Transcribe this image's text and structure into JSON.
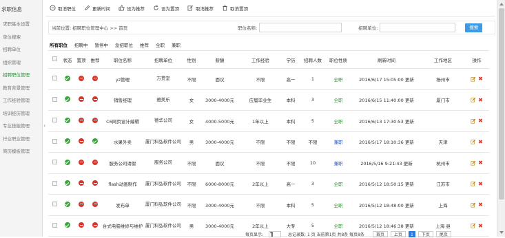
{
  "sidebar": {
    "title": "求职信息",
    "items": [
      {
        "label": "求职基本设置",
        "active": false
      },
      {
        "label": "单位搜索",
        "active": false
      },
      {
        "label": "招聘单位",
        "active": false
      },
      {
        "label": "组织管理",
        "active": false
      },
      {
        "label": "招聘职位管理",
        "active": true
      },
      {
        "label": "教育背景管理",
        "active": false
      },
      {
        "label": "工作经验管理",
        "active": false
      },
      {
        "label": "培训经历管理",
        "active": false
      },
      {
        "label": "专业技能管理",
        "active": false
      },
      {
        "label": "行业职业管理",
        "active": false
      },
      {
        "label": "简历模板管理",
        "active": false
      }
    ]
  },
  "toolbar": {
    "items": [
      {
        "label": "取消职位",
        "icon": "circle-minus-icon"
      },
      {
        "label": "更新时间",
        "icon": "pencil-icon"
      },
      {
        "label": "设为推荐",
        "icon": "thumb-up-icon"
      },
      {
        "label": "设为置顶",
        "icon": "refresh-icon"
      },
      {
        "label": "取消推荐",
        "icon": "edit-icon"
      },
      {
        "label": "取消置顶",
        "icon": "trash-icon"
      }
    ]
  },
  "breadcrumb": "当前位置: 招聘职位管理中心 >> 首页",
  "filters": {
    "position_label": "职位名称:",
    "position_value": "",
    "company_label": "招聘单位:",
    "company_value": "",
    "search_label": "搜索"
  },
  "tabs": [
    {
      "label": "所有职位",
      "active": true
    },
    {
      "label": "招聘中",
      "active": false
    },
    {
      "label": "暂停中",
      "active": false
    },
    {
      "label": "急招职位",
      "active": false
    },
    {
      "label": "推荐",
      "active": false
    },
    {
      "label": "全职",
      "active": false
    },
    {
      "label": "兼职",
      "active": false
    }
  ],
  "columns": [
    "状态",
    "置顶",
    "推荐",
    "职位名称",
    "招聘单位",
    "性别",
    "薪酬",
    "工作经验",
    "学历",
    "招聘人数",
    "职位性质",
    "刷新时间",
    "工作地区",
    "操作"
  ],
  "rows": [
    {
      "status": "green",
      "top": "red",
      "recommend": "red",
      "name": "yz管理",
      "company": "万贯堂",
      "gender": "不限",
      "salary": "面议",
      "experience": "不限",
      "education": "高一",
      "count": "1",
      "nature": "全职",
      "refresh": "2016/6/17 15:05:00 更新",
      "region": "杨州市"
    },
    {
      "status": "green",
      "top": "red",
      "recommend": "red",
      "name": "销售经理",
      "company": "雅美乐",
      "gender": "女",
      "salary": "3000-4000元",
      "experience": "应届毕业生",
      "education": "本科",
      "count": "3",
      "nature": "全职",
      "refresh": "2016/6/15 11:40:00 更新",
      "region": "厦门市"
    },
    {
      "status": "green",
      "top": "red",
      "recommend": "red",
      "name": "C6网页设计编辑",
      "company": "德华公司",
      "gender": "女",
      "salary": "4000-5000元",
      "experience": "1年以上",
      "education": "本科",
      "count": "5",
      "nature": "全职",
      "refresh": "2016/6/13 17:30:53 更新",
      "region": ""
    },
    {
      "status": "green",
      "top": "red",
      "recommend": "green",
      "name": "水果外卖",
      "company": "厦门科弘软件公司",
      "gender": "男",
      "salary": "3000-4000元",
      "experience": "不限",
      "education": "不限",
      "count": "不限",
      "nature": "兼职",
      "refresh": "2016/5/17 18:10:36 更新",
      "region": "天津"
    },
    {
      "status": "green",
      "top": "red",
      "recommend": "red",
      "name": "服务公司请假",
      "company": "服务公司",
      "gender": "不限",
      "salary": "面议",
      "experience": "不限",
      "education": "不限",
      "count": "10",
      "nature": "兼职",
      "refresh": "2016/5/16 9:21:43 更新",
      "region": "杭州市"
    },
    {
      "status": "green",
      "top": "red",
      "recommend": "red",
      "name": "flash动画制作",
      "company": "厦门科弘软件公司",
      "gender": "不限",
      "salary": "6000-8000元",
      "experience": "2年以上",
      "education": "高一",
      "count": "3",
      "nature": "全职",
      "refresh": "2016/5/12 18:50:15 更新",
      "region": "江苏市"
    },
    {
      "status": "green",
      "top": "red",
      "recommend": "red",
      "name": "发布单",
      "company": "厦门科弘软件公司",
      "gender": "不限",
      "salary": "3000-4000元",
      "experience": "不限",
      "education": "本科",
      "count": "5",
      "nature": "全职",
      "refresh": "2016/5/12 18:48:00 更新",
      "region": "上海"
    },
    {
      "status": "green",
      "top": "red",
      "recommend": "red",
      "name": "台式电脑维修与维护",
      "company": "厦门科弘软件公司",
      "gender": "男",
      "salary": "3000-4000元",
      "experience": "2年以上",
      "education": "大专",
      "count": "5",
      "nature": "全职",
      "refresh": "2016/5/12 18:46:38 更新",
      "region": "上海 县"
    }
  ],
  "pager": {
    "per_page_label": "每页显示:",
    "per_page_value": "1",
    "info": "总记录数: 1 页 当前第1页 共8条 每页8条",
    "first": "首页",
    "prev": "上页",
    "current": "1",
    "next": "下页",
    "last": "尾页"
  }
}
